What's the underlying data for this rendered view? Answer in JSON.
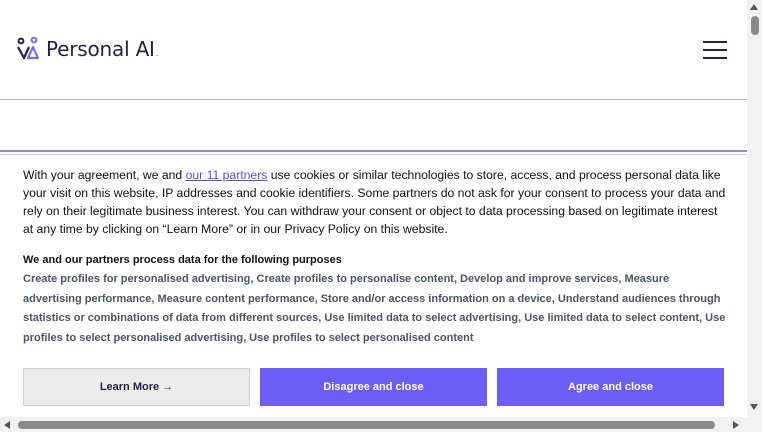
{
  "header": {
    "logo_text": "Personal AI",
    "logo_suffix": ".",
    "logo_icon": "personal-ai-logo-icon",
    "menu_icon": "hamburger-menu-icon"
  },
  "consent": {
    "intro_before_link": "With your agreement, we and ",
    "partners_link": "our 11 partners",
    "intro_after_link": " use cookies or similar technologies to store, access, and process personal data like your visit on this website, IP addresses and cookie identifiers. Some partners do not ask for your consent to process your data and rely on their legitimate business interest. You can withdraw your consent or object to data processing based on legitimate interest at any time by clicking on “Learn More” or in our Privacy Policy on this website.",
    "purposes_title": "We and our partners process data for the following purposes",
    "purposes_text": "Create profiles for personalised advertising, Create profiles to personalise content, Develop and improve services, Measure advertising performance, Measure content performance, Store and/or access information on a device, Understand audiences through statistics or combinations of data from different sources, Use limited data to select advertising, Use limited data to select content, Use profiles to select personalised advertising, Use profiles to select personalised content",
    "buttons": {
      "learn_more": "Learn More →",
      "disagree": "Disagree and close",
      "agree": "Agree and close"
    }
  },
  "colors": {
    "accent": "#6c5ef5",
    "link": "#5b4ce0",
    "brand_text": "#1f2440"
  }
}
